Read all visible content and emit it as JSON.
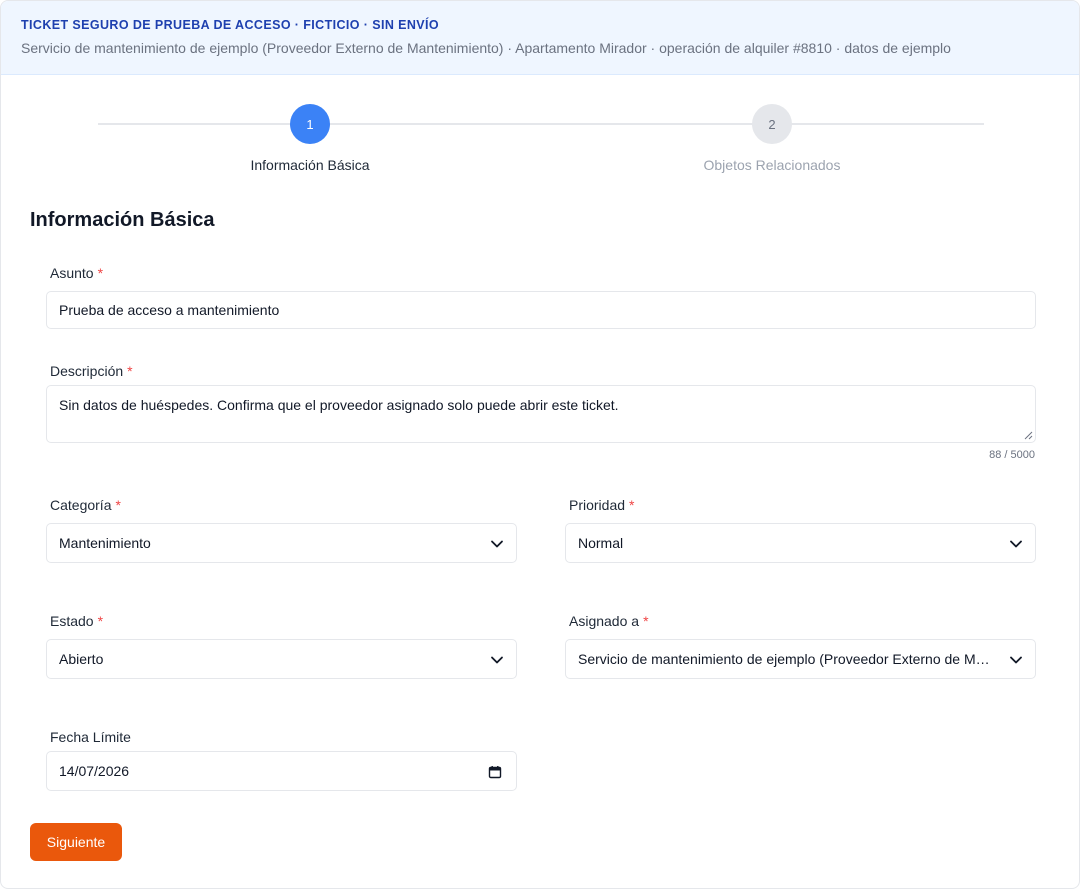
{
  "banner": {
    "title": "TICKET SEGURO DE PRUEBA DE ACCESO · FICTICIO · SIN ENVÍO",
    "subtitle": "Servicio de mantenimiento de ejemplo (Proveedor Externo de Mantenimiento) · Apartamento Mirador · operación de alquiler #8810 · datos de ejemplo"
  },
  "stepper": {
    "steps": [
      {
        "number": "1",
        "label": "Información Básica",
        "state": "active"
      },
      {
        "number": "2",
        "label": "Objetos Relacionados",
        "state": "inactive"
      }
    ]
  },
  "section_title": "Información Básica",
  "form": {
    "required_mark": "*",
    "subject": {
      "label": "Asunto",
      "value": "Prueba de acceso a mantenimiento"
    },
    "description": {
      "label": "Descripción",
      "value": "Sin datos de huéspedes. Confirma que el proveedor asignado solo puede abrir este ticket.",
      "counter": "88 / 5000"
    },
    "category": {
      "label": "Categoría",
      "value": "Mantenimiento"
    },
    "priority": {
      "label": "Prioridad",
      "value": "Normal"
    },
    "status": {
      "label": "Estado",
      "value": "Abierto"
    },
    "assigned_to": {
      "label": "Asignado a",
      "value": "Servicio de mantenimiento de ejemplo (Proveedor Externo de Mantenimiento)"
    },
    "due_date": {
      "label": "Fecha Límite",
      "value": "14/07/2026"
    }
  },
  "actions": {
    "next_label": "Siguiente"
  },
  "colors": {
    "accent_blue": "#3b82f6",
    "banner_bg": "#eff6ff",
    "banner_title": "#1e40af",
    "required": "#ef4444",
    "primary_button": "#ea580c"
  },
  "icons": {
    "select_arrow": "chevron-down-icon",
    "date_picker": "calendar-icon",
    "textarea_resize": "resize-handle-icon"
  }
}
